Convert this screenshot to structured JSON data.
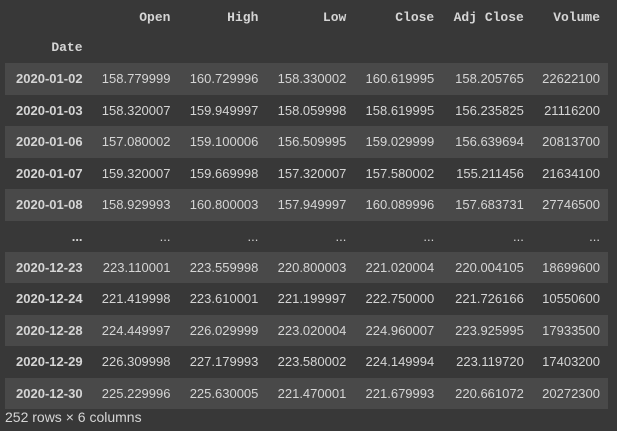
{
  "table": {
    "index_name": "Date",
    "columns": [
      "Open",
      "High",
      "Low",
      "Close",
      "Adj Close",
      "Volume"
    ],
    "rows": [
      {
        "date": "2020-01-02",
        "values": [
          "158.779999",
          "160.729996",
          "158.330002",
          "160.619995",
          "158.205765",
          "22622100"
        ]
      },
      {
        "date": "2020-01-03",
        "values": [
          "158.320007",
          "159.949997",
          "158.059998",
          "158.619995",
          "156.235825",
          "21116200"
        ]
      },
      {
        "date": "2020-01-06",
        "values": [
          "157.080002",
          "159.100006",
          "156.509995",
          "159.029999",
          "156.639694",
          "20813700"
        ]
      },
      {
        "date": "2020-01-07",
        "values": [
          "159.320007",
          "159.669998",
          "157.320007",
          "157.580002",
          "155.211456",
          "21634100"
        ]
      },
      {
        "date": "2020-01-08",
        "values": [
          "158.929993",
          "160.800003",
          "157.949997",
          "160.089996",
          "157.683731",
          "27746500"
        ]
      },
      {
        "date": "...",
        "values": [
          "...",
          "...",
          "...",
          "...",
          "...",
          "..."
        ]
      },
      {
        "date": "2020-12-23",
        "values": [
          "223.110001",
          "223.559998",
          "220.800003",
          "221.020004",
          "220.004105",
          "18699600"
        ]
      },
      {
        "date": "2020-12-24",
        "values": [
          "221.419998",
          "223.610001",
          "221.199997",
          "222.750000",
          "221.726166",
          "10550600"
        ]
      },
      {
        "date": "2020-12-28",
        "values": [
          "224.449997",
          "226.029999",
          "223.020004",
          "224.960007",
          "223.925995",
          "17933500"
        ]
      },
      {
        "date": "2020-12-29",
        "values": [
          "226.309998",
          "227.179993",
          "223.580002",
          "224.149994",
          "223.119720",
          "17403200"
        ]
      },
      {
        "date": "2020-12-30",
        "values": [
          "225.229996",
          "225.630005",
          "221.470001",
          "221.679993",
          "220.661072",
          "20272300"
        ]
      }
    ]
  },
  "footer": {
    "shape_text": "252 rows × 6 columns"
  },
  "colors": {
    "background": "#383838",
    "stripe": "#494949",
    "text": "#d5d5d5"
  }
}
